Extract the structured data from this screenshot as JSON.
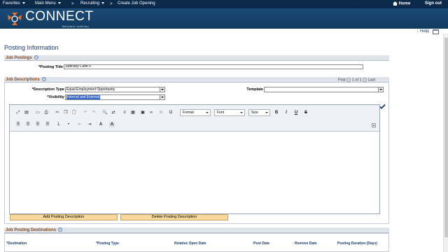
{
  "topbar": {
    "favorites": "Favorites",
    "main_menu": "Main Menu",
    "breadcrumb_sep": ">",
    "recruiting": "Recruiting",
    "create_job_opening": "Create Job Opening",
    "home": "Home",
    "sign_out": "Sign out"
  },
  "banner": {
    "logo_text": "CONNECT",
    "logo_sub": "Maryland Judiciary"
  },
  "utility": {
    "help": "Help"
  },
  "page": {
    "title": "Posting Information"
  },
  "job_postings": {
    "header": "Job Postings",
    "posting_title_label": "*Posting Title",
    "posting_title_value": "Judiciary Clerk II"
  },
  "job_descriptions": {
    "header": "Job Descriptions",
    "pager_first": "First",
    "pager_count": "1 of 1",
    "pager_last": "Last",
    "description_type_label": "*Description Type",
    "description_type_value": "Equal Employment Opportunity",
    "visibility_label": "*Visibility",
    "visibility_value": "Internal and External",
    "template_label": "Template",
    "template_value": ""
  },
  "editor_toolbar": {
    "format": "Format",
    "font": "Font",
    "size": "Size",
    "bold": "B",
    "italic": "I",
    "underline": "U",
    "strike": "S"
  },
  "buttons": {
    "add_posting_description": "Add Posting Description",
    "delete_posting_description": "Delete Posting Description"
  },
  "destinations": {
    "header": "Job Posting Destinations",
    "columns": [
      "*Destination",
      "*Posting Type",
      "Relative Open Date",
      "Post Date",
      "Remove Date",
      "Posting Duration (Days)"
    ]
  }
}
